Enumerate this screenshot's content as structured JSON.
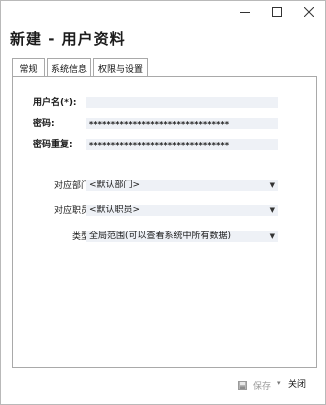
{
  "window": {
    "title": "新建 - 用户资料",
    "controls": {
      "minimize": "minimize",
      "maximize": "maximize",
      "close": "close"
    }
  },
  "tabs": [
    {
      "label": "常规",
      "active": true
    },
    {
      "label": "系统信息",
      "active": false
    },
    {
      "label": "权限与设置",
      "active": false
    }
  ],
  "form": {
    "username": {
      "label": "用户名(*):",
      "value": ""
    },
    "password": {
      "label": "密码:",
      "value": "********************************"
    },
    "password_confirm": {
      "label": "密码重复:",
      "value": "********************************"
    },
    "department": {
      "label": "对应部门:",
      "value": "<默认部门>"
    },
    "employee": {
      "label": "对应职员:",
      "value": "<默认职员>"
    },
    "type": {
      "label": "类型:",
      "value": "全局范围(可以查看系统中所有数据)"
    }
  },
  "footer": {
    "save_label": "保存",
    "close_label": "关闭"
  },
  "colors": {
    "field_bg": "#eef1f6",
    "border": "#a9a9a9",
    "disabled_text": "#9a9a9a"
  }
}
